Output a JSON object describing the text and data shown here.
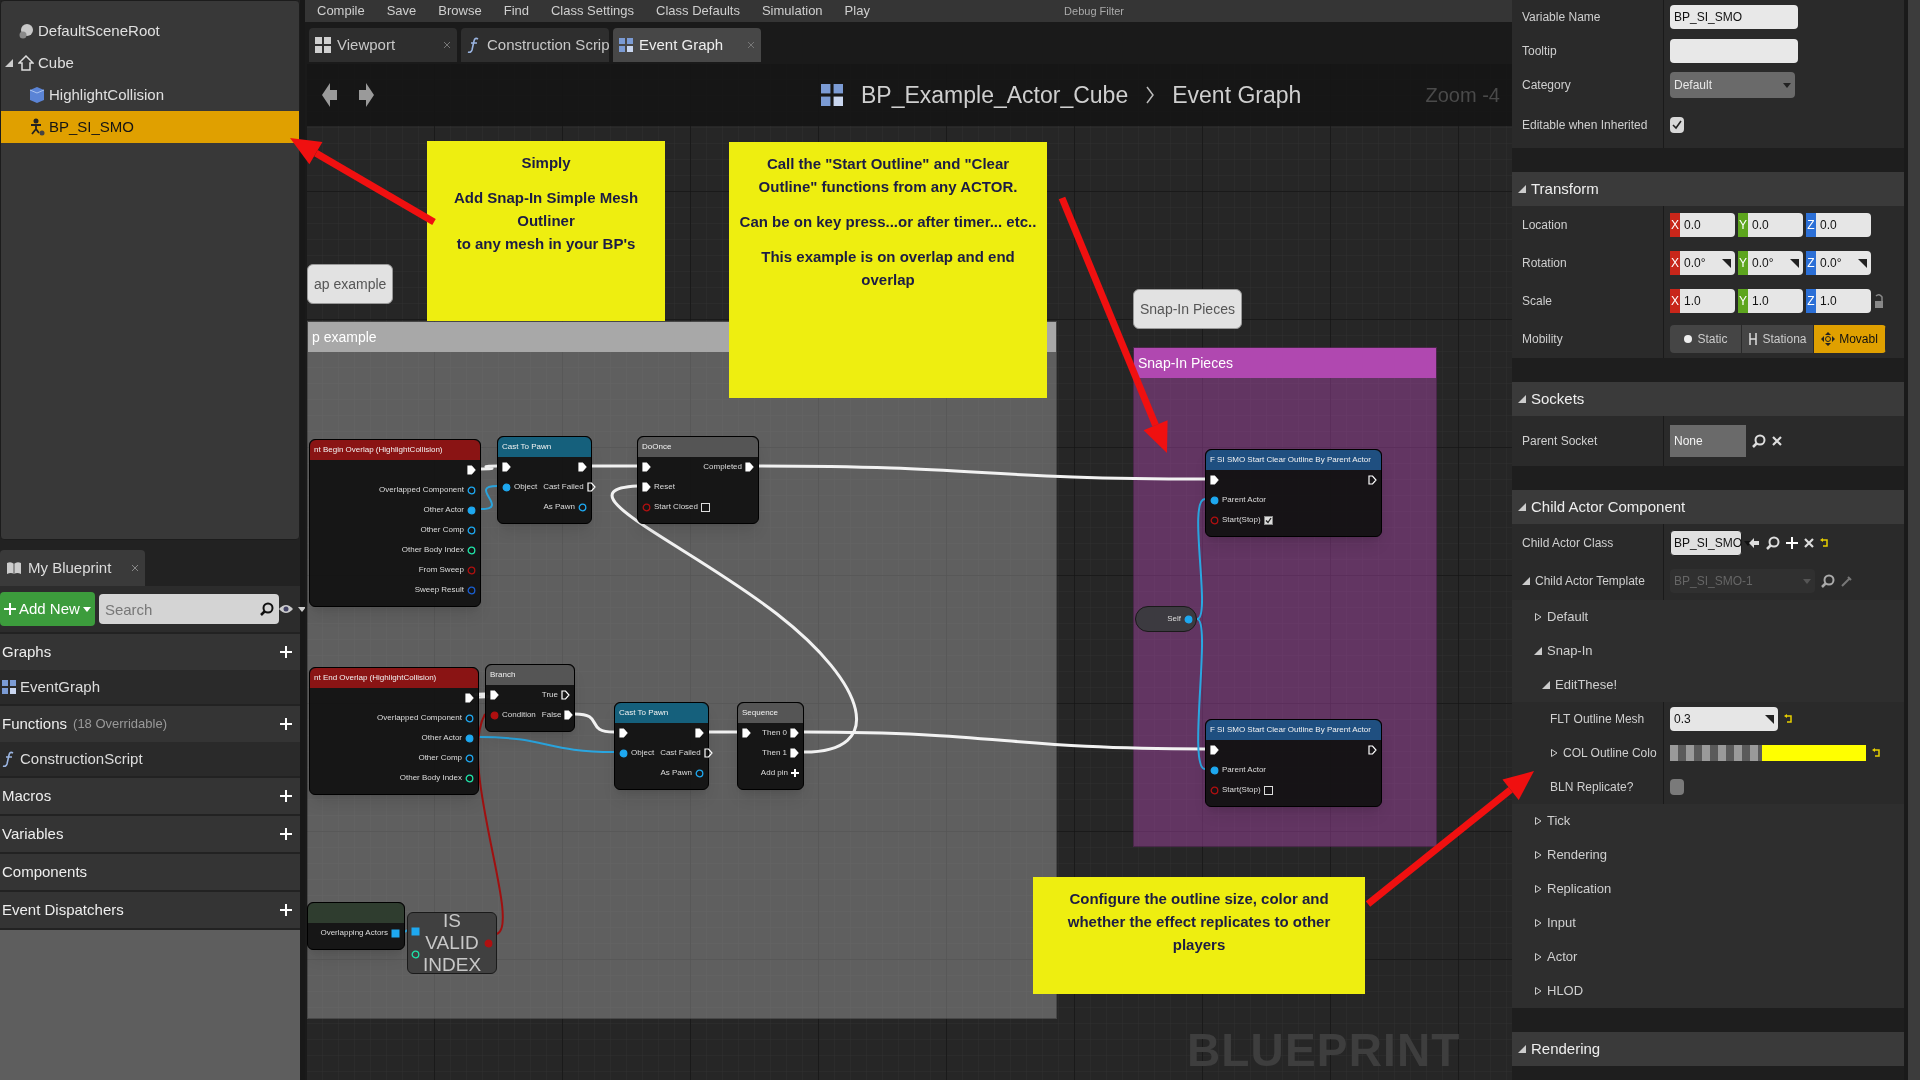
{
  "toolbar": {
    "buttons": [
      "Compile",
      "Save",
      "Browse",
      "Find",
      "Class Settings",
      "Class Defaults",
      "Simulation",
      "Play"
    ],
    "debug_filter": "Debug Filter"
  },
  "components": {
    "items": [
      {
        "label": "DefaultSceneRoot",
        "kind": "scene",
        "selected": false
      },
      {
        "label": "Cube",
        "kind": "mesh",
        "selected": false,
        "expanded": true,
        "children": [
          {
            "label": "HighlightCollision",
            "kind": "box",
            "selected": false
          },
          {
            "label": "BP_SI_SMO",
            "kind": "actor",
            "selected": true
          }
        ]
      }
    ]
  },
  "my_blueprint": {
    "tab": "My Blueprint",
    "add_new": "Add New",
    "search": {
      "placeholder": "Search"
    },
    "sections": [
      {
        "title": "Graphs",
        "can_add": true,
        "items": [
          {
            "label": "EventGraph",
            "kind": "graph"
          }
        ]
      },
      {
        "title": "Functions",
        "note": "(18 Overridable)",
        "can_add": true,
        "items": [
          {
            "label": "ConstructionScript",
            "kind": "function"
          }
        ]
      },
      {
        "title": "Macros",
        "can_add": true
      },
      {
        "title": "Variables",
        "can_add": true
      },
      {
        "title": "Components",
        "can_add": false
      },
      {
        "title": "Event Dispatchers",
        "can_add": true
      }
    ]
  },
  "editor_tabs": [
    {
      "label": "Viewport",
      "kind": "viewport",
      "selected": false
    },
    {
      "label": "Construction Scrip",
      "kind": "function",
      "selected": false
    },
    {
      "label": "Event Graph",
      "kind": "graph",
      "selected": true
    }
  ],
  "graph": {
    "breadcrumb": [
      "BP_Example_Actor_Cube",
      "Event Graph"
    ],
    "zoom": "Zoom -4",
    "watermark": "BLUEPRINT",
    "comments": [
      {
        "title": "p example",
        "bubble": "ap example",
        "color": "#a8a8a8"
      },
      {
        "title": "Snap-In Pieces",
        "bubble": "Snap-In Pieces",
        "color": "#b048b0"
      }
    ],
    "notes": [
      {
        "paragraphs": [
          "Simply",
          "Add Snap-In Simple Mesh Outliner\nto any mesh in your BP's"
        ]
      },
      {
        "paragraphs": [
          "Call the \"Start Outline\" and \"Clear Outline\" functions from any ACTOR.",
          "Can be on key press...or after timer... etc..",
          "This example is on overlap and end overlap"
        ]
      },
      {
        "paragraphs": [
          "Configure the outline size, color and whether the effect replicates to other players"
        ]
      }
    ],
    "nodes": [
      {
        "kind": "event",
        "title": "nt Begin Overlap (HighlightCollision)",
        "outputs": [
          {
            "kind": "exec",
            "linked": true
          },
          {
            "label": "Overlapped Component",
            "kind": "object",
            "linked": false
          },
          {
            "label": "Other Actor",
            "kind": "object",
            "linked": true
          },
          {
            "label": "Other Comp",
            "kind": "object",
            "linked": false
          },
          {
            "label": "Other Body Index",
            "kind": "int",
            "linked": false
          },
          {
            "label": "From Sweep",
            "kind": "bool",
            "linked": false
          },
          {
            "label": "Sweep Result",
            "kind": "struct",
            "linked": false
          }
        ]
      },
      {
        "kind": "cast",
        "title": "Cast To Pawn",
        "inputs": [
          {
            "kind": "exec",
            "linked": true
          },
          {
            "label": "Object",
            "kind": "object",
            "linked": true
          }
        ],
        "outputs": [
          {
            "kind": "exec",
            "linked": true
          },
          {
            "label": "Cast Failed",
            "kind": "exec",
            "linked": false
          },
          {
            "label": "As Pawn",
            "kind": "object",
            "linked": false
          }
        ]
      },
      {
        "kind": "macro",
        "title": "DoOnce",
        "inputs": [
          {
            "kind": "exec",
            "linked": true
          },
          {
            "label": "Reset",
            "kind": "exec",
            "linked": true
          },
          {
            "label": "Start Closed",
            "kind": "bool",
            "linked": false,
            "checked": false
          }
        ],
        "outputs": [
          {
            "label": "Completed",
            "kind": "exec",
            "linked": true
          }
        ]
      },
      {
        "kind": "event",
        "title": "nt End Overlap (HighlightCollision)",
        "outputs": [
          {
            "kind": "exec",
            "linked": true
          },
          {
            "label": "Overlapped Component",
            "kind": "object",
            "linked": false
          },
          {
            "label": "Other Actor",
            "kind": "object",
            "linked": true
          },
          {
            "label": "Other Comp",
            "kind": "object",
            "linked": false
          },
          {
            "label": "Other Body Index",
            "kind": "int",
            "linked": false
          }
        ]
      },
      {
        "kind": "flow",
        "title": "Branch",
        "inputs": [
          {
            "kind": "exec",
            "linked": true
          },
          {
            "label": "Condition",
            "kind": "bool",
            "linked": true
          }
        ],
        "outputs": [
          {
            "label": "True",
            "kind": "exec",
            "linked": false
          },
          {
            "label": "False",
            "kind": "exec",
            "linked": true
          }
        ]
      },
      {
        "kind": "cast",
        "title": "Cast To Pawn",
        "inputs": [
          {
            "kind": "exec",
            "linked": true
          },
          {
            "label": "Object",
            "kind": "object",
            "linked": true
          }
        ],
        "outputs": [
          {
            "kind": "exec",
            "linked": true
          },
          {
            "label": "Cast Failed",
            "kind": "exec",
            "linked": false
          },
          {
            "label": "As Pawn",
            "kind": "object",
            "linked": false
          }
        ]
      },
      {
        "kind": "flow",
        "title": "Sequence",
        "inputs": [
          {
            "kind": "exec",
            "linked": true
          }
        ],
        "outputs": [
          {
            "label": "Then 0",
            "kind": "exec",
            "linked": true
          },
          {
            "label": "Then 1",
            "kind": "exec",
            "linked": true
          },
          {
            "label": "Add pin",
            "kind": "add"
          }
        ]
      },
      {
        "kind": "partial",
        "outputs": [
          {
            "label": "Overlapping Actors",
            "kind": "array",
            "linked": true
          }
        ]
      },
      {
        "kind": "compact",
        "title": "IS VALID INDEX",
        "inputs": [
          {
            "kind": "array",
            "linked": true
          },
          {
            "kind": "int",
            "linked": false
          }
        ],
        "outputs": [
          {
            "kind": "bool",
            "linked": true
          }
        ]
      },
      {
        "kind": "self",
        "title": "Self",
        "outputs": [
          {
            "kind": "object",
            "linked": true
          }
        ]
      },
      {
        "kind": "function",
        "title": "F SI SMO Start Clear Outline By Parent Actor",
        "inputs": [
          {
            "kind": "exec",
            "linked": true
          },
          {
            "label": "Parent Actor",
            "kind": "object",
            "linked": true
          },
          {
            "label": "Start(Stop)",
            "kind": "bool",
            "linked": false,
            "checked": true
          }
        ],
        "outputs": [
          {
            "kind": "exec",
            "linked": false
          }
        ]
      },
      {
        "kind": "function",
        "title": "F SI SMO Start Clear Outline By Parent Actor",
        "inputs": [
          {
            "kind": "exec",
            "linked": true
          },
          {
            "label": "Parent Actor",
            "kind": "object",
            "linked": true
          },
          {
            "label": "Start(Stop)",
            "kind": "bool",
            "linked": false,
            "checked": false
          }
        ],
        "outputs": [
          {
            "kind": "exec",
            "linked": false
          }
        ]
      }
    ]
  },
  "details": {
    "rows": [
      {
        "kind": "text",
        "label": "Variable Name",
        "value": "BP_SI_SMO"
      },
      {
        "kind": "text",
        "label": "Tooltip"
      },
      {
        "kind": "dropdown",
        "label": "Category",
        "value": "Default"
      },
      {
        "kind": "checkbox",
        "label": "Editable when Inherited",
        "checked": true
      }
    ],
    "sections": [
      {
        "title": "Transform",
        "expanded": true,
        "rows": [
          {
            "kind": "vector",
            "label": "Location",
            "values": [
              {
                "axis": "X",
                "value": "0.0"
              },
              {
                "axis": "Y",
                "value": "0.0"
              },
              {
                "axis": "Z",
                "value": "0.0"
              }
            ]
          },
          {
            "kind": "vector",
            "label": "Rotation",
            "spinner": true,
            "values": [
              {
                "axis": "X",
                "value": "0.0°"
              },
              {
                "axis": "Y",
                "value": "0.0°"
              },
              {
                "axis": "Z",
                "value": "0.0°"
              }
            ]
          },
          {
            "kind": "vector",
            "label": "Scale",
            "locked": false,
            "values": [
              {
                "axis": "X",
                "value": "1.0"
              },
              {
                "axis": "Y",
                "value": "1.0"
              },
              {
                "axis": "Z",
                "value": "1.0"
              }
            ]
          },
          {
            "kind": "segmented",
            "label": "Mobility",
            "options": [
              {
                "label": "Static",
                "selected": false
              },
              {
                "label": "Stationa",
                "selected": false
              },
              {
                "label": "Movabl",
                "selected": true
              }
            ]
          }
        ]
      },
      {
        "title": "Sockets",
        "expanded": true,
        "rows": [
          {
            "kind": "socket",
            "label": "Parent Socket",
            "value": "None"
          }
        ]
      },
      {
        "title": "Child Actor Component",
        "expanded": true,
        "rows": [
          {
            "kind": "asset",
            "label": "Child Actor Class",
            "value": "BP_SI_SMO"
          },
          {
            "kind": "template",
            "label": "Child Actor Template",
            "value": "BP_SI_SMO-1",
            "expanded": true,
            "disabled": true,
            "children": [
              {
                "kind": "category",
                "label": "Default",
                "expanded": false
              },
              {
                "kind": "category",
                "label": "Snap-In",
                "expanded": true,
                "children": [
                  {
                    "kind": "category",
                    "label": "EditThese!",
                    "expanded": true,
                    "children": [
                      {
                        "kind": "number",
                        "label": "FLT Outline Mesh",
                        "value": "0.3"
                      },
                      {
                        "kind": "color",
                        "label": "COL Outline Colo",
                        "color": "#ffff00",
                        "expanded": false
                      },
                      {
                        "kind": "checkbox",
                        "label": "BLN Replicate?",
                        "checked": false
                      }
                    ]
                  }
                ]
              },
              {
                "kind": "category",
                "label": "Tick",
                "expanded": false
              },
              {
                "kind": "category",
                "label": "Rendering",
                "expanded": false
              },
              {
                "kind": "category",
                "label": "Replication",
                "expanded": false
              },
              {
                "kind": "category",
                "label": "Input",
                "expanded": false
              },
              {
                "kind": "category",
                "label": "Actor",
                "expanded": false
              },
              {
                "kind": "category",
                "label": "HLOD",
                "expanded": false
              }
            ]
          }
        ]
      },
      {
        "title": "Rendering",
        "expanded": true
      }
    ]
  }
}
